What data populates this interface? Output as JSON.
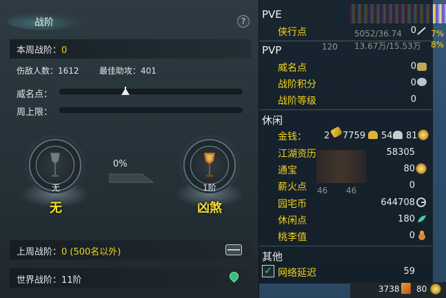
{
  "left": {
    "title": "战阶",
    "help": "?",
    "weekly_rank_label": "本周战阶：",
    "weekly_rank_value": "0",
    "kills_label": "伤敌人数：",
    "kills_value": "1612",
    "best_assist_label": "最佳助攻：",
    "best_assist_value": "401",
    "prestige_label": "威名点：",
    "weekly_cap_label": "周上限：",
    "prestige_progress": 0.36,
    "current_rank_level": "无",
    "current_rank_name": "无",
    "progress_pct": "0%",
    "next_rank_level": "1阶",
    "next_rank_name": "凶煞",
    "last_week_label": "上周战阶：",
    "last_week_value": "0 (500名以外)",
    "world_rank_label": "世界战阶：",
    "world_rank_value": "11阶"
  },
  "right": {
    "bg_stat_1": "5052/36.74",
    "bg_stat_2": "13.67万/15.53万",
    "bg_pct_1": "7%",
    "bg_pct_2": "8%",
    "bg_level": "120",
    "bg_num_1": "46",
    "bg_num_2": "46",
    "pve": {
      "title": "PVE",
      "items": [
        {
          "label": "侠行点",
          "value": "0"
        }
      ]
    },
    "pvp": {
      "title": "PVP",
      "items": [
        {
          "label": "威名点",
          "value": "0"
        },
        {
          "label": "战阶积分",
          "value": "0"
        },
        {
          "label": "战阶等级",
          "value": "0"
        }
      ]
    },
    "leisure": {
      "title": "休闲",
      "gold_label": "金钱：",
      "gold_ingot": "2",
      "gold_gold": "7759",
      "gold_silver": "54",
      "gold_copper": "81",
      "items": [
        {
          "label": "江湖资历",
          "value": "58305"
        },
        {
          "label": "通宝",
          "value": "80"
        },
        {
          "label": "薪火点",
          "value": "0"
        },
        {
          "label": "园宅币",
          "value": "644708"
        },
        {
          "label": "休闲点",
          "value": "180"
        },
        {
          "label": "桃李值",
          "value": "0"
        }
      ]
    },
    "other": {
      "title": "其他",
      "items": [
        {
          "label": "网络延迟",
          "value": "59",
          "checked": true
        }
      ]
    },
    "bottom": {
      "value_1": "3738",
      "value_2": "80"
    }
  },
  "colors": {
    "accent_yellow": "#f3d21f",
    "text_light": "#e8ecee",
    "check_green": "#59d36f"
  }
}
